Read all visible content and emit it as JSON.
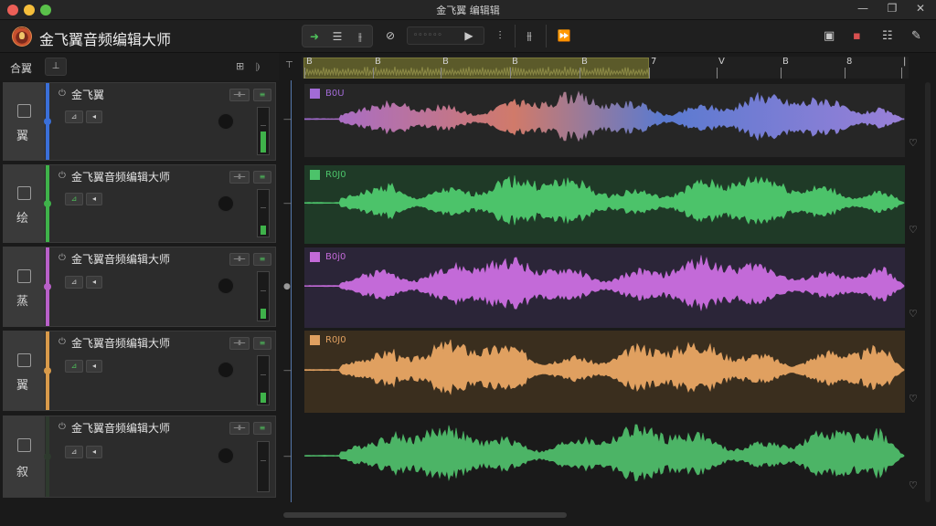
{
  "window": {
    "title": "金飞翼  编辑辑"
  },
  "app": {
    "name": "金飞翼音频编辑大师"
  },
  "track_panel": {
    "header_label": "合翼",
    "add_button": "⊥"
  },
  "timeline": {
    "region_color": "#5b5a2a",
    "ruler_labels": [
      "B",
      "B",
      "B",
      "B",
      "B",
      "7",
      "V",
      "B",
      "8",
      "|"
    ]
  },
  "tracks": [
    {
      "name": "金飞翼",
      "side_label": "翼",
      "clip_label": "B0U",
      "color": "#3a6fd8",
      "wave_top": "#a26bd6",
      "wave_mid": "#d07a6a",
      "wave_end": "#9a80d8",
      "lane_bg": "#262626",
      "meter_level": 0.45
    },
    {
      "name": "金飞翼音频编辑大师",
      "side_label": "绘",
      "clip_label": "R0J0",
      "color": "#3fb24a",
      "wave_top": "#4cc36a",
      "wave_mid": "#4cc36a",
      "wave_end": "#4cc36a",
      "lane_bg": "#1f3a27",
      "meter_level": 0.2
    },
    {
      "name": "金飞翼音频编辑大师",
      "side_label": "蒸",
      "clip_label": "B0j0",
      "color": "#b860c8",
      "wave_top": "#c36ad8",
      "wave_mid": "#c36ad8",
      "wave_end": "#c36ad8",
      "lane_bg": "#2b2538",
      "meter_level": 0.2
    },
    {
      "name": "金飞翼音频编辑大师",
      "side_label": "翼",
      "clip_label": "R0J0",
      "color": "#d89a4a",
      "wave_top": "#e0a060",
      "wave_mid": "#e0a060",
      "wave_end": "#e0a060",
      "lane_bg": "#3a2e1e",
      "meter_level": 0.2
    },
    {
      "name": "金飞翼音频编辑大师",
      "side_label": "叙",
      "clip_label": "",
      "color": "#2e3a2e",
      "wave_top": "#4cb466",
      "wave_mid": "#4cb466",
      "wave_end": "#4cb466",
      "lane_bg": "#1a1a1a",
      "meter_level": 0.0
    }
  ]
}
